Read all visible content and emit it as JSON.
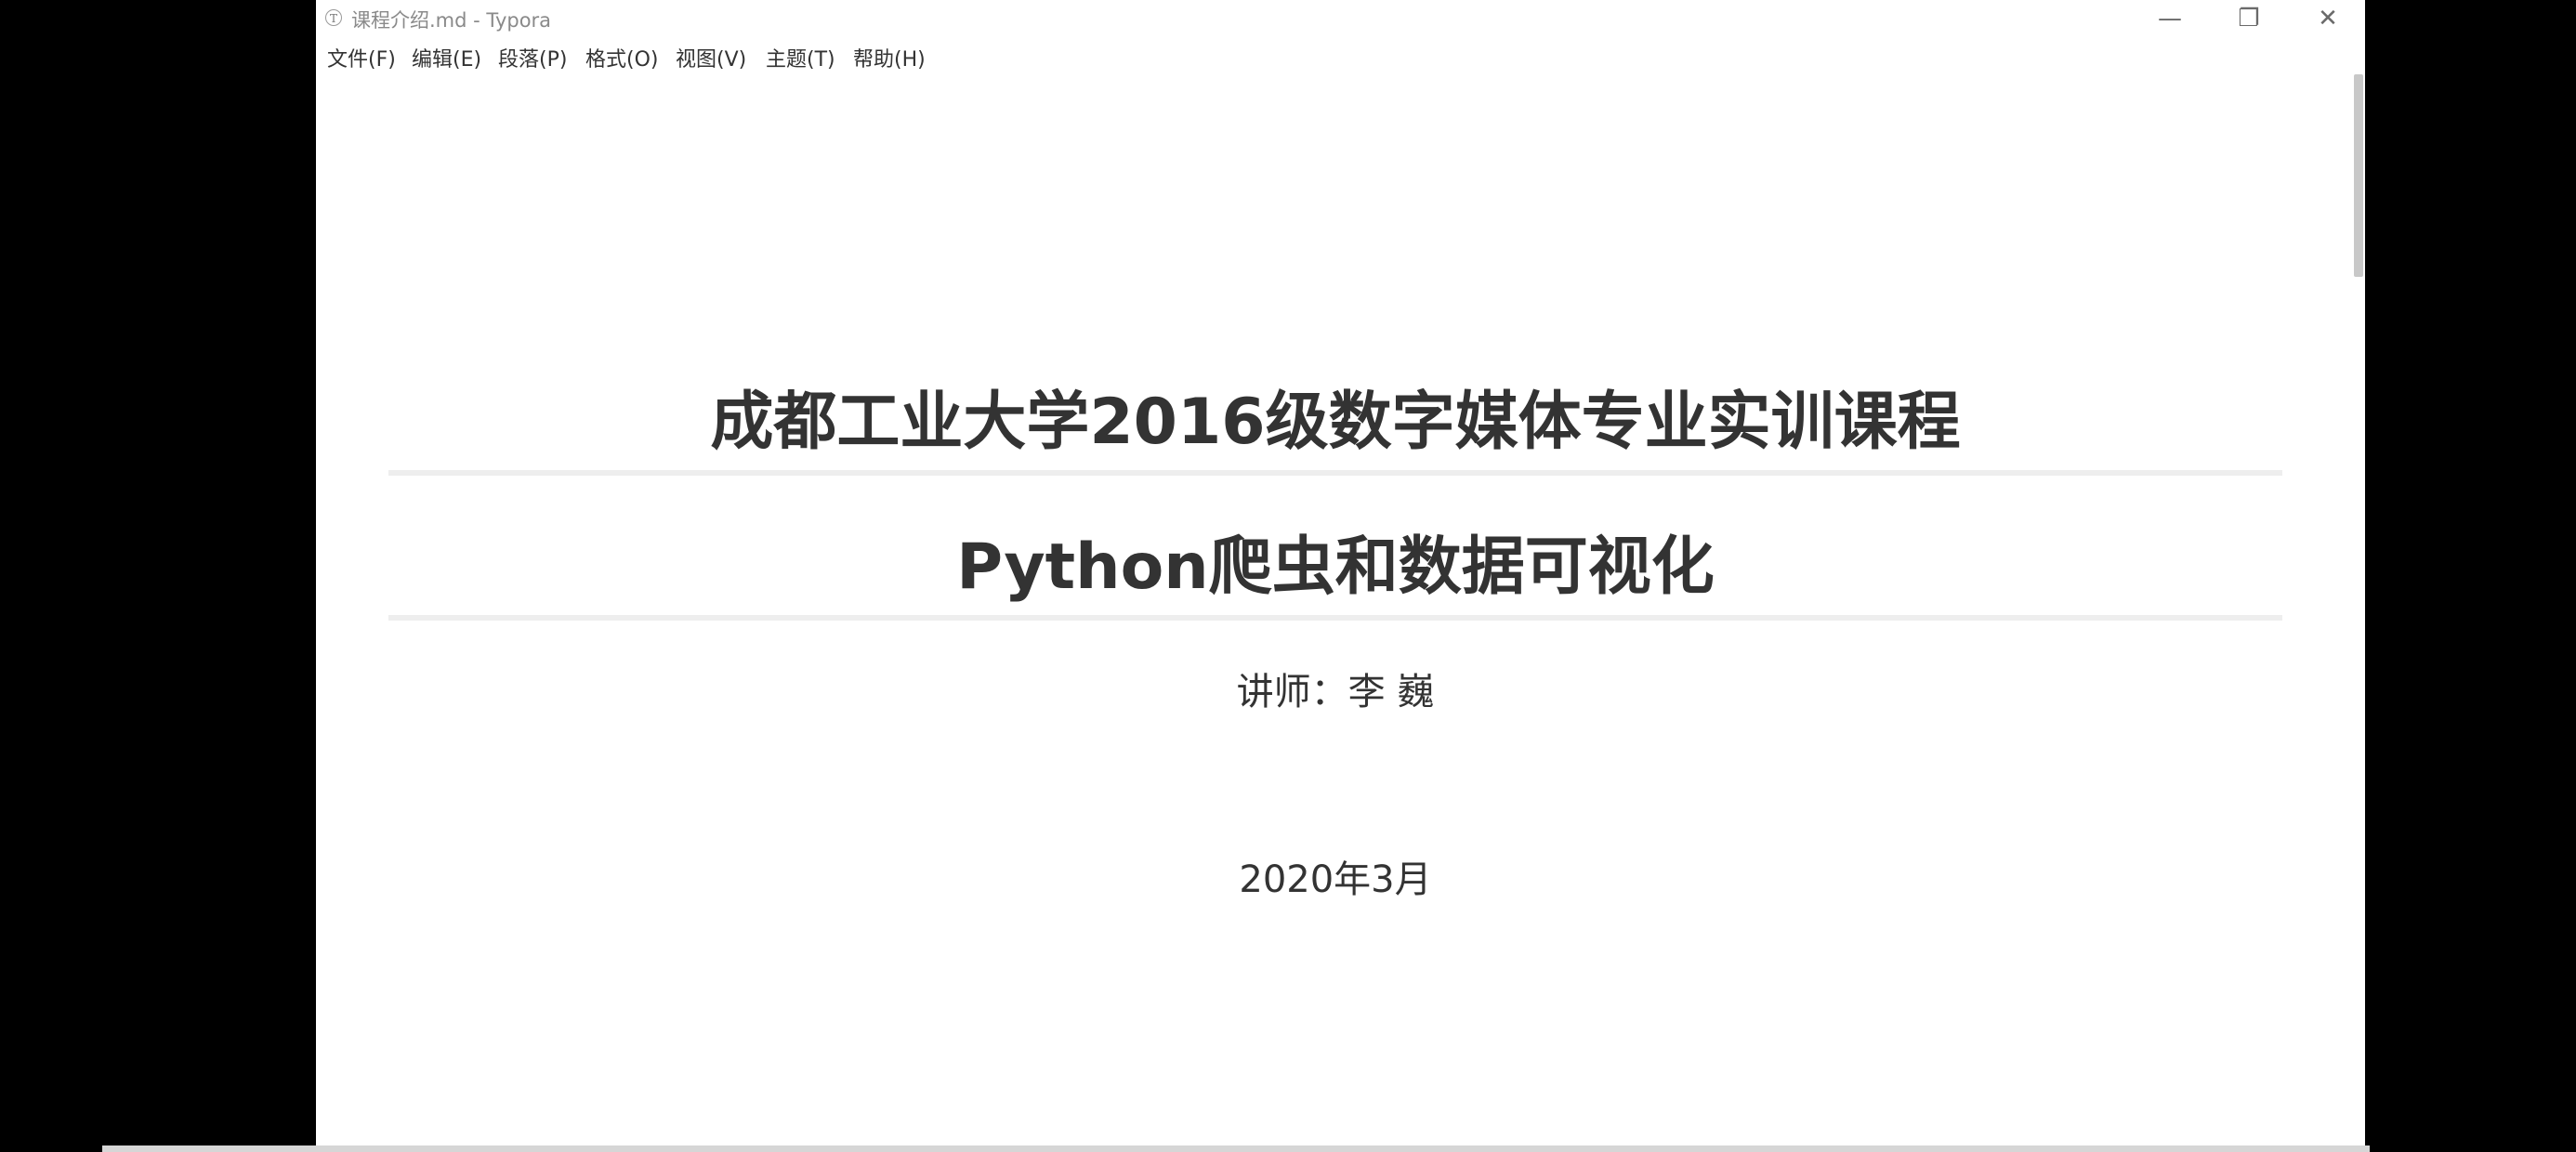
{
  "window": {
    "title": "课程介绍.md - Typora",
    "app_icon_glyph": "T",
    "controls": {
      "minimize_glyph": "—",
      "maximize_glyph": "❐",
      "close_glyph": "✕"
    }
  },
  "menu": {
    "items": [
      {
        "label": "文件(F)"
      },
      {
        "label": "编辑(E)"
      },
      {
        "label": "段落(P)"
      },
      {
        "label": "格式(O)"
      },
      {
        "label": "视图(V)"
      },
      {
        "label": "主题(T)"
      },
      {
        "label": "帮助(H)"
      }
    ]
  },
  "document": {
    "heading_main": "成都工业大学2016级数字媒体专业实训课程",
    "heading_sub": "Python爬虫和数据可视化",
    "lecturer": "讲师：李 巍",
    "date": "2020年3月"
  },
  "colors": {
    "background": "#000000",
    "window": "#ffffff",
    "text": "#333333",
    "rule": "#eeeeee"
  }
}
